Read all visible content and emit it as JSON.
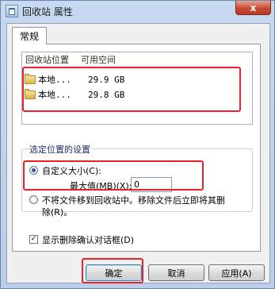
{
  "window": {
    "title": "回收站 属性",
    "close_glyph": "x"
  },
  "tabs": [
    {
      "label": "常规"
    }
  ],
  "locations": {
    "columns": [
      "回收站位置",
      "可用空间"
    ],
    "rows": [
      {
        "name": "本地...",
        "free": "29.9 GB"
      },
      {
        "name": "本地...",
        "free": "29.8 GB"
      }
    ]
  },
  "settings": {
    "group_label": "选定位置的设置",
    "custom_size_label": "自定义大小(C):",
    "max_value_label": "最大值(MB)(X):",
    "max_value": "0",
    "no_move_label_line1": "不将文件移到回收站中。移除文件后立即将其删",
    "no_move_label_line2": "除(R)。",
    "confirm_label": "显示删除确认对话框(D)",
    "confirm_checked": true
  },
  "buttons": {
    "ok": "确定",
    "cancel": "取消",
    "apply": "应用(A)"
  },
  "colors": {
    "highlight": "#e8232a"
  }
}
